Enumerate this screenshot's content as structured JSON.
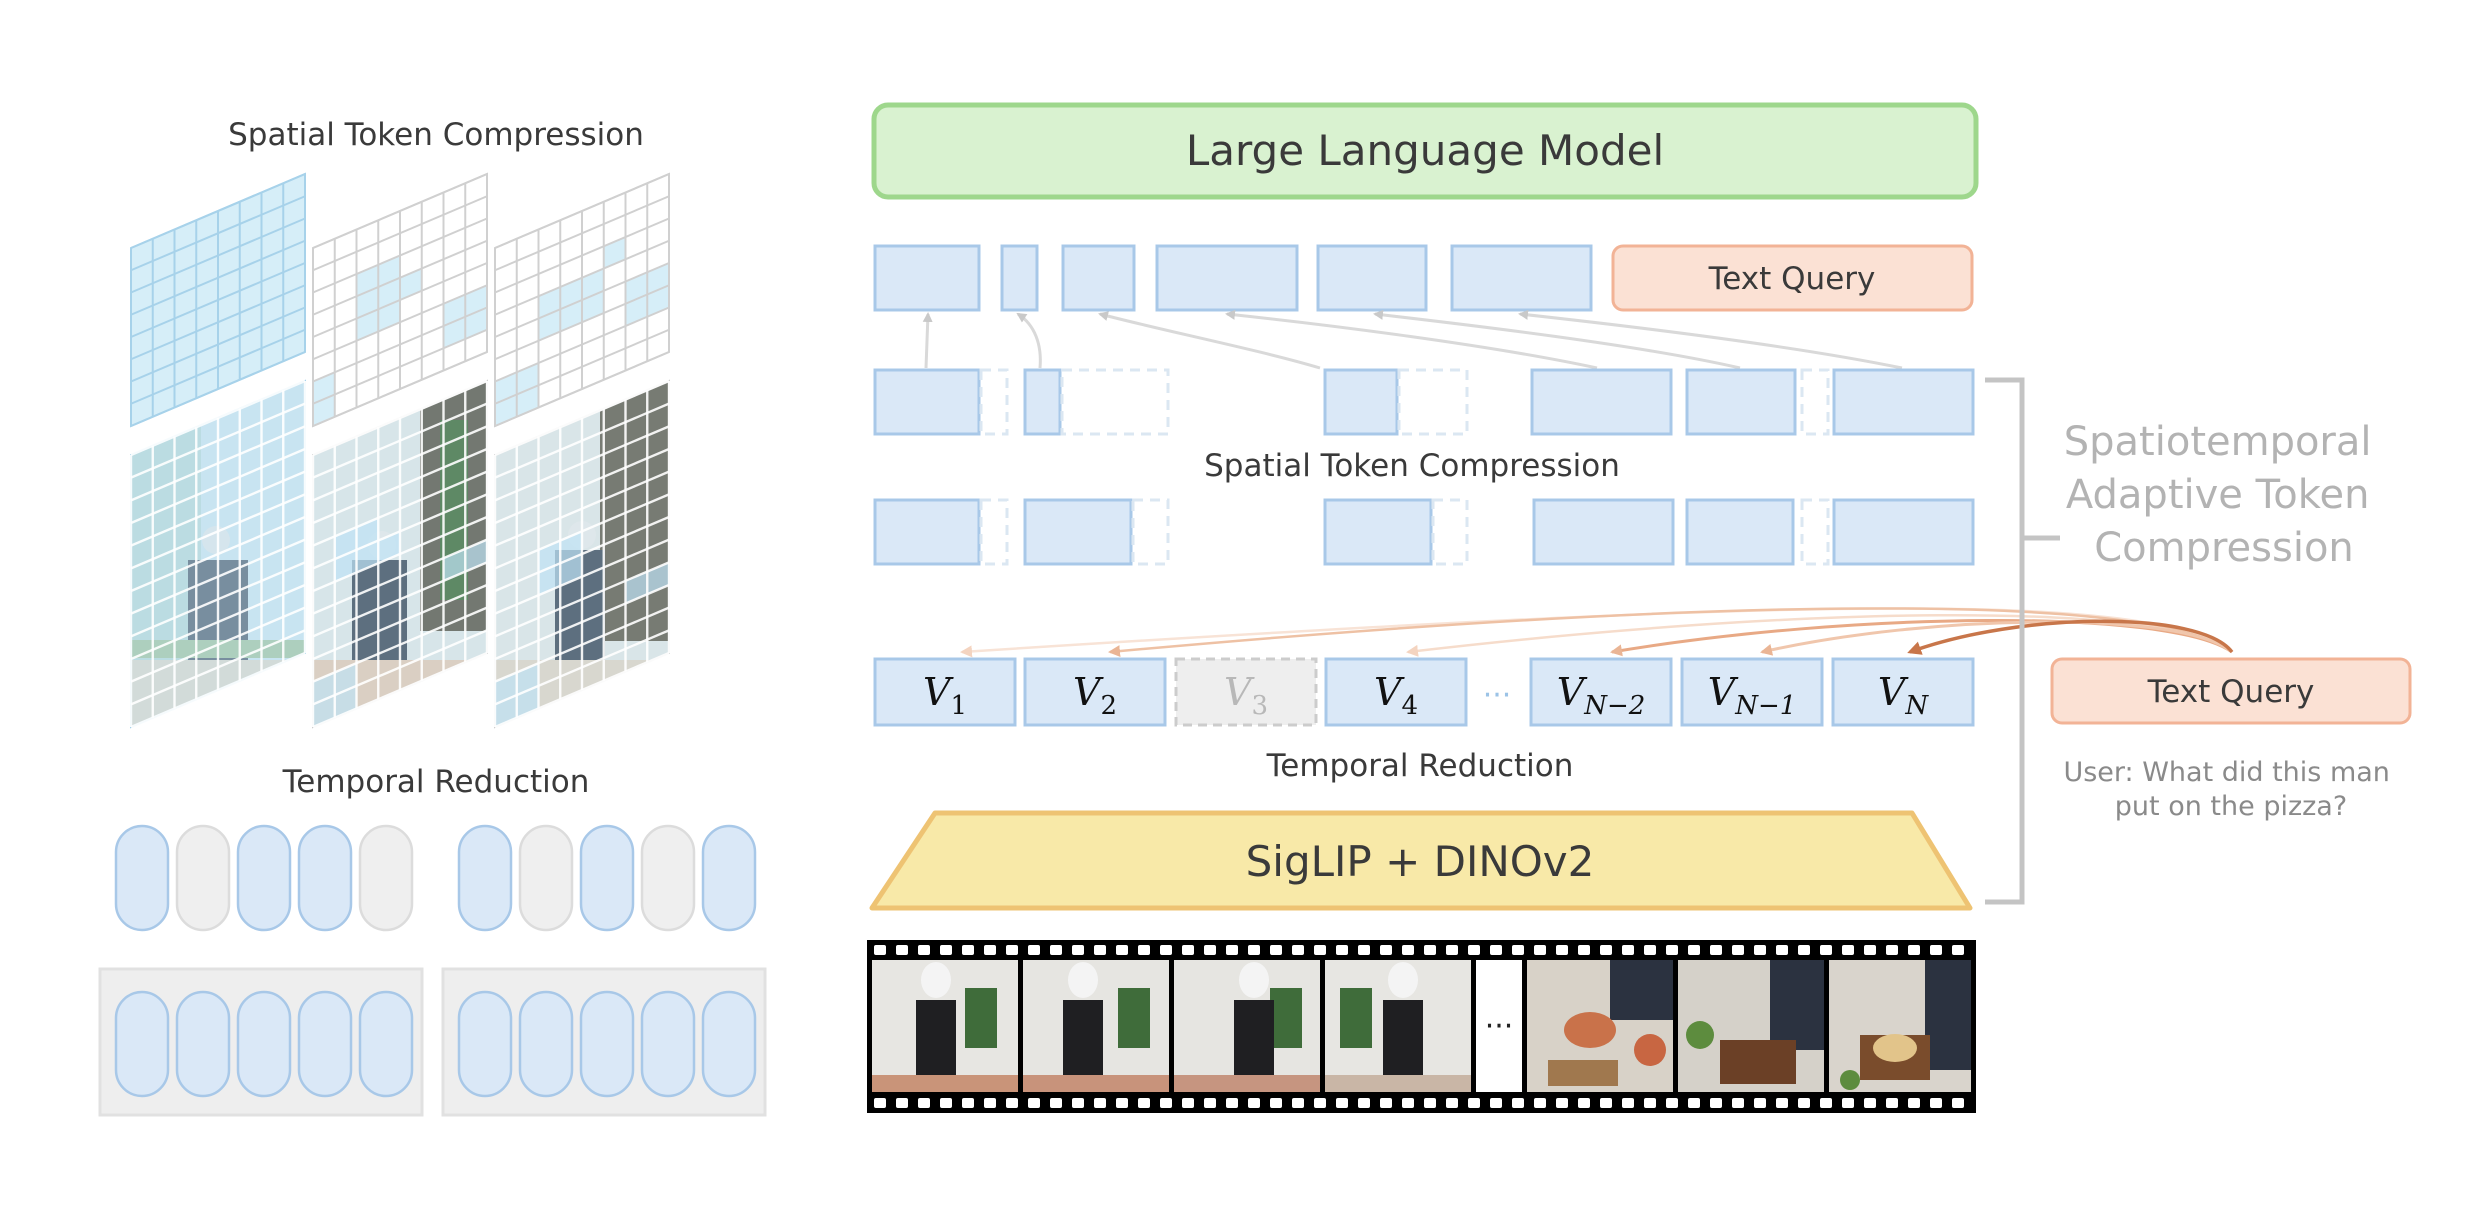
{
  "left_panel": {
    "spatial_title": "Spatial Token Compression",
    "temporal_title": "Temporal Reduction"
  },
  "main": {
    "llm_label": "Large Language Model",
    "text_query_top": "Text Query",
    "spatial_compression_label": "Spatial Token Compression",
    "temporal_reduction_label": "Temporal Reduction",
    "encoder_label": "SigLIP + DINOv2",
    "ellipsis": "···",
    "film_ellipsis": "···",
    "tokens": [
      {
        "base": "V",
        "sub": "1"
      },
      {
        "base": "V",
        "sub": "2"
      },
      {
        "base": "V",
        "sub": "3"
      },
      {
        "base": "V",
        "sub": "4"
      },
      {
        "base": "V",
        "sub": "N−2"
      },
      {
        "base": "V",
        "sub": "N−1"
      },
      {
        "base": "V",
        "sub": "N"
      }
    ]
  },
  "right_panel": {
    "bracket_title_lines": [
      "Spatiotemporal",
      "Adaptive Token",
      "Compression"
    ],
    "text_query": "Text Query",
    "user_query_lines": [
      "User: What did this man",
      "put on the pizza?"
    ]
  },
  "colors": {
    "token_fill": "#dae8f7",
    "token_stroke": "#a8c8e8",
    "llm_fill": "#d9f2d0",
    "llm_stroke": "#9ed78c",
    "query_fill": "#fbe1d4",
    "query_stroke": "#f2b396",
    "encoder_fill": "#f8e9a8",
    "encoder_stroke": "#eec373",
    "arrow_orange": "#c8764a",
    "gray_text": "#b3b3b3"
  }
}
